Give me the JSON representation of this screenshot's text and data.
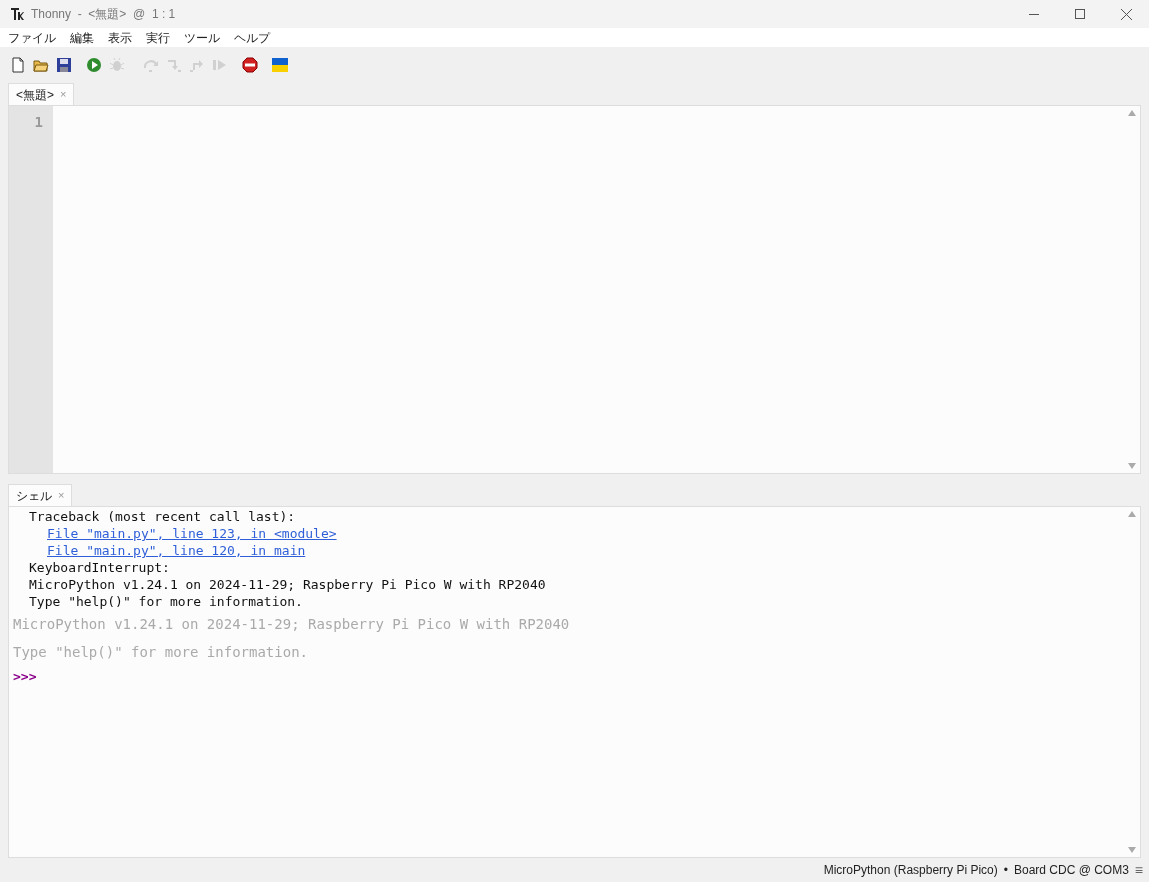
{
  "window": {
    "title": "Thonny  -  <無題>  @  1 : 1"
  },
  "menu": [
    "ファイル",
    "編集",
    "表示",
    "実行",
    "ツール",
    "ヘルプ"
  ],
  "toolbar": [
    {
      "kind": "new",
      "disabled": false
    },
    {
      "kind": "open",
      "disabled": false
    },
    {
      "kind": "save",
      "disabled": false
    },
    {
      "kind": "run",
      "disabled": false
    },
    {
      "kind": "debug",
      "disabled": true
    },
    {
      "kind": "step-over",
      "disabled": true
    },
    {
      "kind": "step-into",
      "disabled": true
    },
    {
      "kind": "step-out",
      "disabled": true
    },
    {
      "kind": "resume",
      "disabled": true
    },
    {
      "kind": "stop",
      "disabled": false
    },
    {
      "kind": "flag",
      "disabled": false
    }
  ],
  "editor": {
    "tabs": [
      {
        "label": "<無題>",
        "close": "×",
        "selected": true
      }
    ],
    "line_numbers": [
      "1"
    ]
  },
  "shell": {
    "tabs": [
      {
        "label": "シェル",
        "close": "×",
        "selected": true
      }
    ],
    "lines": [
      {
        "kind": "output",
        "text": "Traceback (most recent call last):"
      },
      {
        "kind": "link",
        "text": "File \"main.py\", line 123, in <module>"
      },
      {
        "kind": "link",
        "text": "File \"main.py\", line 120, in main"
      },
      {
        "kind": "output",
        "text": "KeyboardInterrupt:"
      },
      {
        "kind": "output",
        "text": "MicroPython v1.24.1 on 2024-11-29; Raspberry Pi Pico W with RP2040"
      },
      {
        "kind": "output",
        "text": "Type \"help()\" for more information."
      },
      {
        "kind": "banner",
        "text": "MicroPython v1.24.1 on 2024-11-29; Raspberry Pi Pico W with RP2040"
      },
      {
        "kind": "banner",
        "text": "Type \"help()\" for more information."
      },
      {
        "kind": "prompt",
        "text": ">>>"
      }
    ]
  },
  "status_bar": {
    "interpreter": "MicroPython (Raspberry Pi Pico)",
    "separator": "•",
    "port": "Board CDC @ COM3",
    "menu": "≡"
  }
}
